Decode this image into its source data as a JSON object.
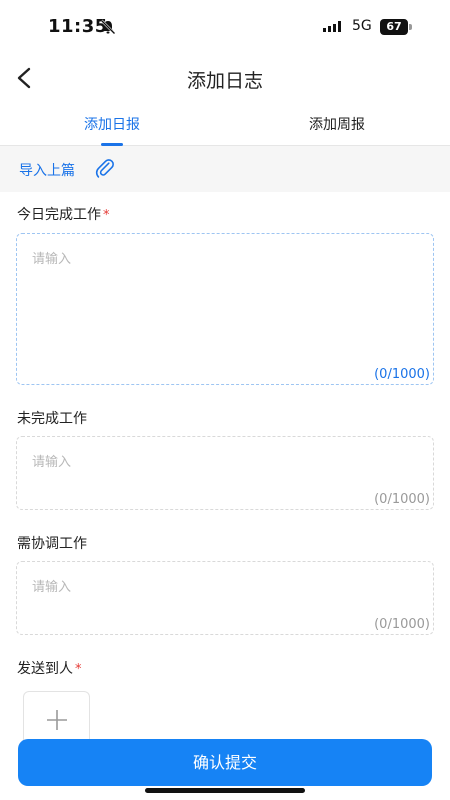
{
  "status_bar": {
    "time": "11:35",
    "network": "5G",
    "battery": "67"
  },
  "nav": {
    "title": "添加日志"
  },
  "tabs": [
    {
      "label": "添加日报",
      "active": true
    },
    {
      "label": "添加周报",
      "active": false
    }
  ],
  "import": {
    "label": "导入上篇"
  },
  "fields": {
    "completed": {
      "label": "今日完成工作",
      "required_mark": "*",
      "placeholder": "请输入",
      "counter": "(0/1000)"
    },
    "unfinished": {
      "label": "未完成工作",
      "placeholder": "请输入",
      "counter": "(0/1000)"
    },
    "coordination": {
      "label": "需协调工作",
      "placeholder": "请输入",
      "counter": "(0/1000)"
    },
    "recipients": {
      "label": "发送到人",
      "required_mark": "*"
    }
  },
  "submit": {
    "label": "确认提交"
  },
  "colors": {
    "accent": "#1a73e8",
    "button": "#1683f5",
    "required": "#e53935"
  },
  "icons": [
    "bell-slash-icon",
    "signal-icon",
    "battery-icon",
    "back-arrow-icon",
    "paperclip-icon",
    "plus-icon"
  ]
}
